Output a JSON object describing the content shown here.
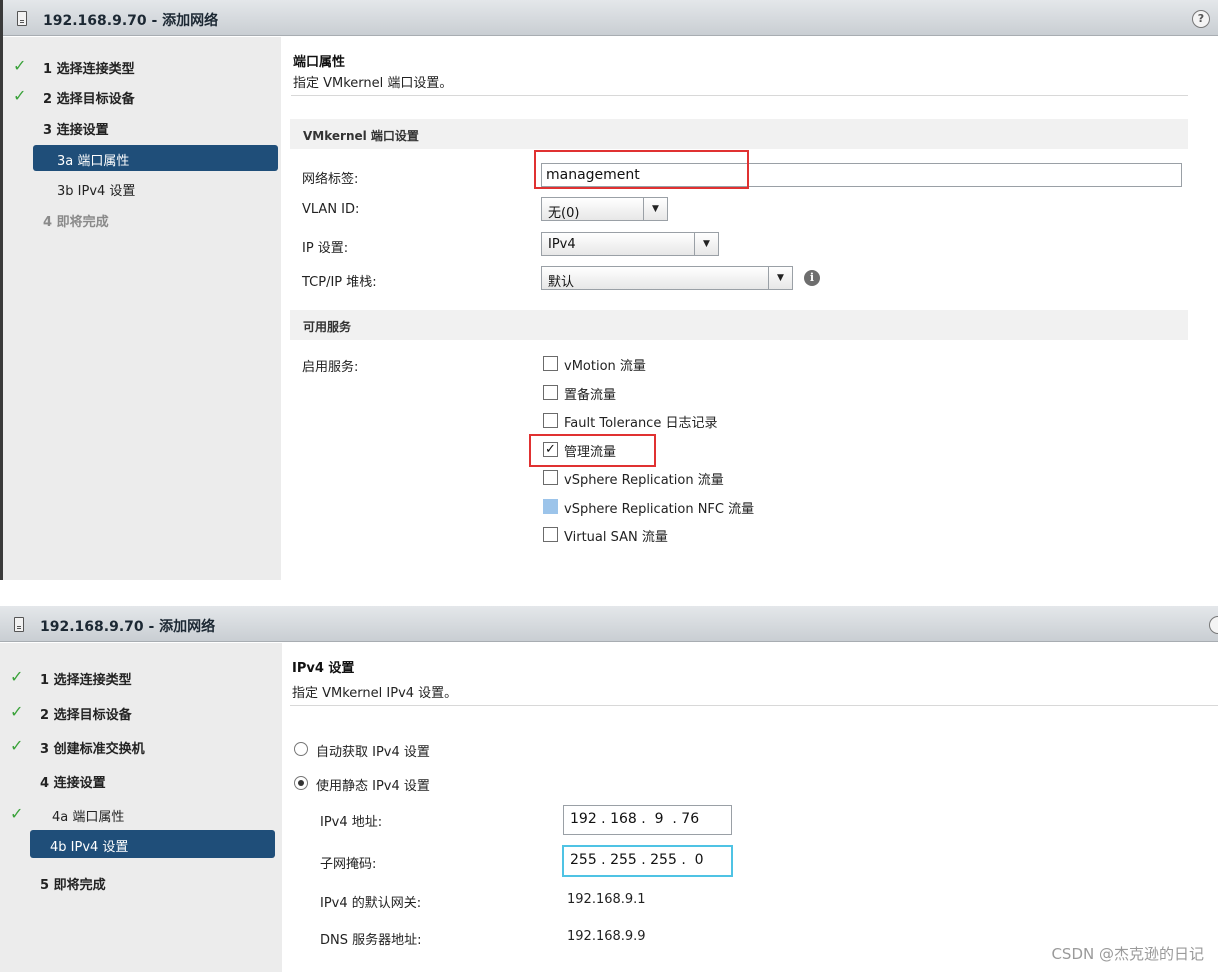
{
  "window1": {
    "title": "192.168.9.70 - 添加网络",
    "steps": [
      {
        "label": "1 选择连接类型",
        "state": "done"
      },
      {
        "label": "2 选择目标设备",
        "state": "done"
      },
      {
        "label": "3 连接设置",
        "state": "current-parent"
      },
      {
        "label": "3a 端口属性",
        "state": "active"
      },
      {
        "label": "3b IPv4 设置",
        "state": "sub"
      },
      {
        "label": "4 即将完成",
        "state": "disabled"
      }
    ],
    "pane_title": "端口属性",
    "pane_subtitle": "指定 VMkernel 端口设置。",
    "section_vmk": "VMkernel 端口设置",
    "network_label_label": "网络标签:",
    "network_label_value": "management",
    "vlan_label": "VLAN ID:",
    "vlan_value": "无(0)",
    "ip_settings_label": "IP 设置:",
    "ip_settings_value": "IPv4",
    "tcpip_label": "TCP/IP 堆栈:",
    "tcpip_value": "默认",
    "section_services": "可用服务",
    "enable_services_label": "启用服务:",
    "services": [
      {
        "label": "vMotion 流量",
        "checked": false,
        "enabled": true
      },
      {
        "label": "置备流量",
        "checked": false,
        "enabled": true
      },
      {
        "label": "Fault Tolerance 日志记录",
        "checked": false,
        "enabled": true
      },
      {
        "label": "管理流量",
        "checked": true,
        "enabled": true
      },
      {
        "label": "vSphere Replication 流量",
        "checked": false,
        "enabled": true
      },
      {
        "label": "vSphere Replication NFC 流量",
        "checked": false,
        "enabled": false
      },
      {
        "label": "Virtual SAN 流量",
        "checked": false,
        "enabled": true
      }
    ],
    "check_mark": "✓"
  },
  "window2": {
    "title": "192.168.9.70 - 添加网络",
    "steps": [
      {
        "label": "1 选择连接类型",
        "state": "done"
      },
      {
        "label": "2 选择目标设备",
        "state": "done"
      },
      {
        "label": "3 创建标准交换机",
        "state": "done"
      },
      {
        "label": "4 连接设置",
        "state": "current-parent"
      },
      {
        "label": "4a 端口属性",
        "state": "done-sub"
      },
      {
        "label": "4b IPv4 设置",
        "state": "active"
      },
      {
        "label": "5 即将完成",
        "state": "pending"
      }
    ],
    "pane_title": "IPv4 设置",
    "pane_subtitle": "指定 VMkernel IPv4 设置。",
    "radio_auto": "自动获取 IPv4 设置",
    "radio_static": "使用静态 IPv4 设置",
    "ipv4_address_label": "IPv4 地址:",
    "ipv4_address_value": "192 . 168 .  9  . 76",
    "subnet_mask_label": "子网掩码:",
    "subnet_mask_value": "255 . 255 . 255 .  0",
    "gateway_label": "IPv4 的默认网关:",
    "gateway_value": "192.168.9.1",
    "dns_label": "DNS 服务器地址:",
    "dns_value": "192.168.9.9"
  },
  "icons": {
    "help": "?",
    "info": "i",
    "dropdown_arrow": "▼",
    "done_check": "✓"
  },
  "colors": {
    "active_step_bg": "#1f4e79",
    "done_check": "#3aa23a",
    "highlight_border": "#e03131",
    "focus_border": "#4fc3e4"
  },
  "watermark": "CSDN @杰克逊的日记"
}
